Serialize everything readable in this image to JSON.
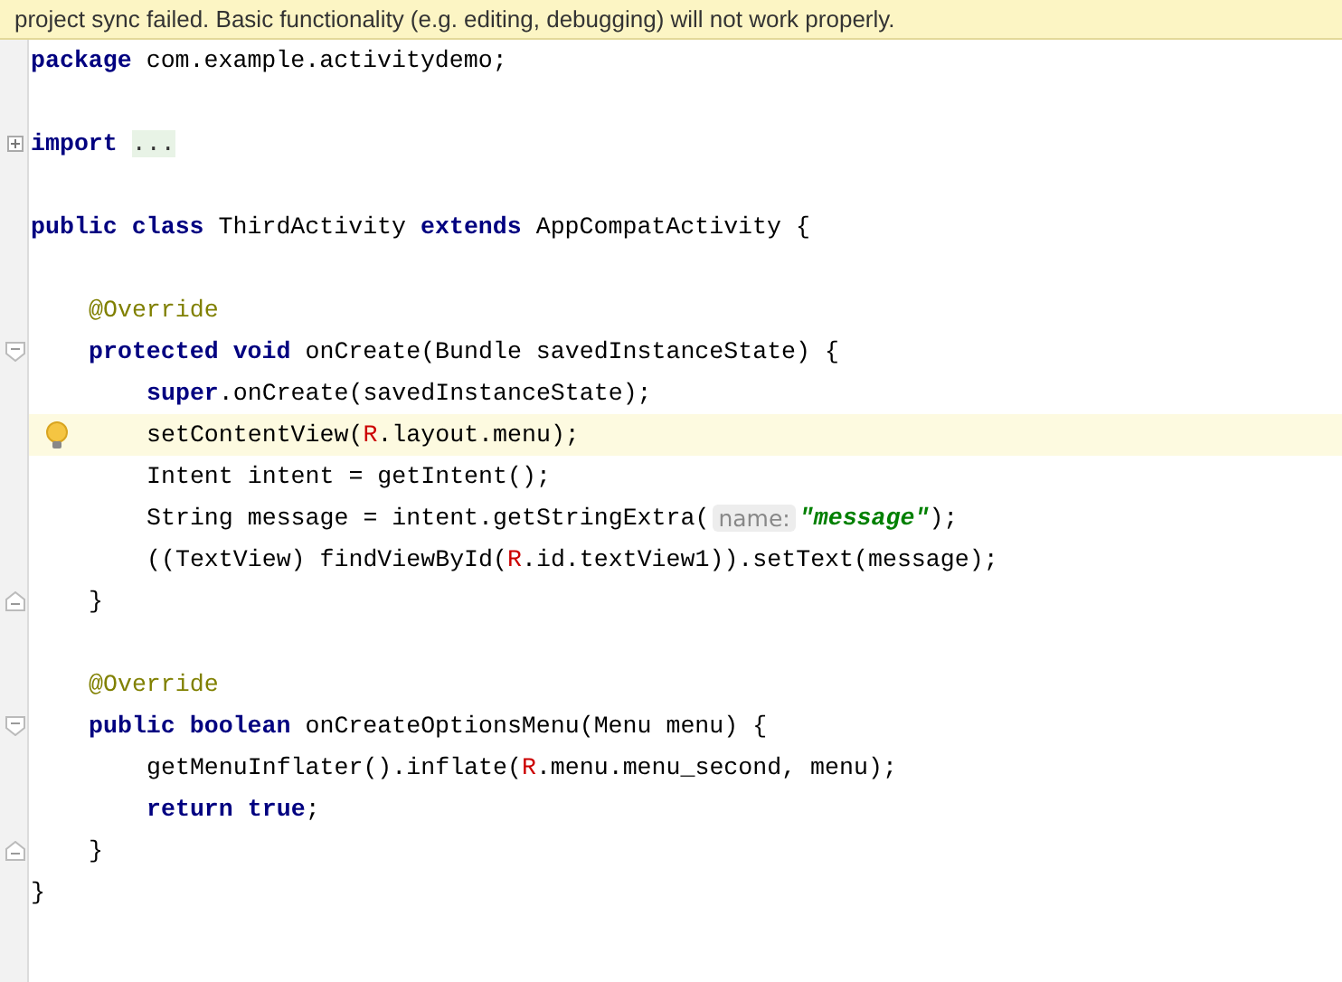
{
  "banner": {
    "text": "project sync failed. Basic functionality (e.g. editing, debugging) will not work properly."
  },
  "editor": {
    "lines": [
      {
        "kind": "code",
        "tokens": [
          {
            "kind": "keyword",
            "text": "package"
          },
          {
            "kind": "plain",
            "text": " com.example.activitydemo;"
          }
        ]
      },
      {
        "kind": "blank"
      },
      {
        "kind": "collapsed",
        "tokens": [
          {
            "kind": "keyword",
            "text": "import"
          },
          {
            "kind": "space"
          },
          {
            "kind": "folded",
            "text": "..."
          }
        ]
      },
      {
        "kind": "blank"
      },
      {
        "kind": "code",
        "tokens": [
          {
            "kind": "keyword",
            "text": "public"
          },
          {
            "kind": "space"
          },
          {
            "kind": "keyword",
            "text": "class"
          },
          {
            "kind": "plain",
            "text": " ThirdActivity "
          },
          {
            "kind": "keyword",
            "text": "extends"
          },
          {
            "kind": "plain",
            "text": " AppCompatActivity {"
          }
        ],
        "children": [
          {
            "kind": "blank"
          },
          {
            "kind": "code",
            "tokens": [
              {
                "kind": "annotation",
                "text": "@Override"
              }
            ]
          },
          {
            "kind": "fold_start",
            "tokens": [
              {
                "kind": "keyword",
                "text": "protected"
              },
              {
                "kind": "space"
              },
              {
                "kind": "keyword",
                "text": "void"
              },
              {
                "kind": "plain",
                "text": " onCreate(Bundle savedInstanceState) {"
              }
            ],
            "children": [
              {
                "kind": "code",
                "tokens": [
                  {
                    "kind": "keyword",
                    "text": "super"
                  },
                  {
                    "kind": "plain",
                    "text": ".onCreate(savedInstanceState);"
                  }
                ]
              },
              {
                "kind": "code",
                "highlighted": true,
                "bulb": true,
                "tokens": [
                  {
                    "kind": "plain",
                    "text": "setContentView("
                  },
                  {
                    "kind": "resource",
                    "text": "R"
                  },
                  {
                    "kind": "plain",
                    "text": ".layout.menu);"
                  }
                ]
              },
              {
                "kind": "code",
                "tokens": [
                  {
                    "kind": "plain",
                    "text": "Intent intent = getIntent();"
                  }
                ]
              },
              {
                "kind": "code",
                "tokens": [
                  {
                    "kind": "plain",
                    "text": "String message = intent.getStringExtra("
                  },
                  {
                    "kind": "hint",
                    "text": "name:"
                  },
                  {
                    "kind": "string",
                    "text": "\"message\""
                  },
                  {
                    "kind": "plain",
                    "text": ");"
                  }
                ]
              },
              {
                "kind": "code",
                "tokens": [
                  {
                    "kind": "plain",
                    "text": "((TextView) findViewById("
                  },
                  {
                    "kind": "resource",
                    "text": "R"
                  },
                  {
                    "kind": "plain",
                    "text": ".id.textView1)).setText(message);"
                  }
                ]
              }
            ]
          },
          {
            "kind": "fold_end",
            "tokens": [
              {
                "kind": "plain",
                "text": "}"
              }
            ]
          },
          {
            "kind": "blank"
          },
          {
            "kind": "code",
            "tokens": [
              {
                "kind": "annotation",
                "text": "@Override"
              }
            ]
          },
          {
            "kind": "fold_start",
            "tokens": [
              {
                "kind": "keyword",
                "text": "public"
              },
              {
                "kind": "space"
              },
              {
                "kind": "keyword",
                "text": "boolean"
              },
              {
                "kind": "plain",
                "text": " onCreateOptionsMenu(Menu menu) {"
              }
            ],
            "children": [
              {
                "kind": "code",
                "tokens": [
                  {
                    "kind": "plain",
                    "text": "getMenuInflater().inflate("
                  },
                  {
                    "kind": "resource",
                    "text": "R"
                  },
                  {
                    "kind": "plain",
                    "text": ".menu.menu_second, menu);"
                  }
                ]
              },
              {
                "kind": "code",
                "tokens": [
                  {
                    "kind": "keyword",
                    "text": "return"
                  },
                  {
                    "kind": "space"
                  },
                  {
                    "kind": "keyword",
                    "text": "true"
                  },
                  {
                    "kind": "plain",
                    "text": ";"
                  }
                ]
              }
            ]
          },
          {
            "kind": "fold_end",
            "tokens": [
              {
                "kind": "plain",
                "text": "}"
              }
            ]
          }
        ]
      },
      {
        "kind": "code",
        "tokens": [
          {
            "kind": "plain",
            "text": "}"
          }
        ]
      }
    ]
  }
}
